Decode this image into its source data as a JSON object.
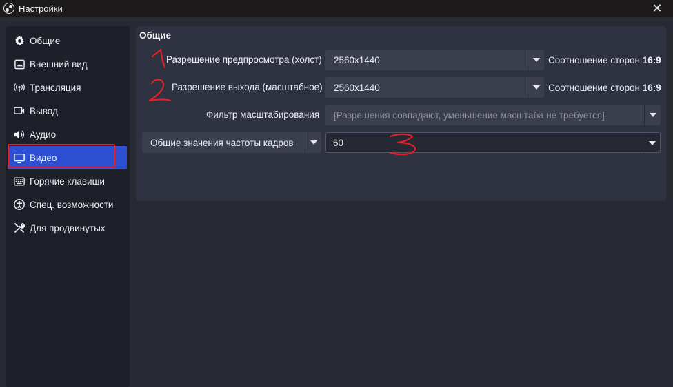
{
  "window": {
    "title": "Настройки",
    "close_symbol": "✕"
  },
  "sidebar": {
    "items": [
      {
        "label": "Общие",
        "icon": "gear-icon"
      },
      {
        "label": "Внешний вид",
        "icon": "appearance-icon"
      },
      {
        "label": "Трансляция",
        "icon": "broadcast-icon"
      },
      {
        "label": "Вывод",
        "icon": "output-icon"
      },
      {
        "label": "Аудио",
        "icon": "speaker-icon"
      },
      {
        "label": "Видео",
        "icon": "monitor-icon",
        "active": true
      },
      {
        "label": "Горячие клавиши",
        "icon": "keyboard-icon"
      },
      {
        "label": "Спец. возможности",
        "icon": "accessibility-icon"
      },
      {
        "label": "Для продвинутых",
        "icon": "tools-icon"
      }
    ]
  },
  "video": {
    "section_title": "Общие",
    "base_resolution": {
      "label": "Разрешение предпросмотра (холст)",
      "value": "2560x1440",
      "ratio_label": "Соотношение сторон",
      "ratio_value": "16:9"
    },
    "output_resolution": {
      "label": "Разрешение выхода (масштабное)",
      "value": "2560x1440",
      "ratio_label": "Соотношение сторон",
      "ratio_value": "16:9"
    },
    "downscale_filter": {
      "label": "Фильтр масштабирования",
      "value": "[Разрешения совпадают, уменьшение масштаба не требуется]"
    },
    "fps": {
      "type_value": "Общие значения частоты кадров",
      "value": "60"
    }
  },
  "annotations": {
    "color": "#e0222a",
    "marks": [
      "1",
      "2",
      "3"
    ]
  },
  "colors": {
    "accent": "#2d4fd2",
    "panel": "#2f3240",
    "background": "#272a33"
  }
}
